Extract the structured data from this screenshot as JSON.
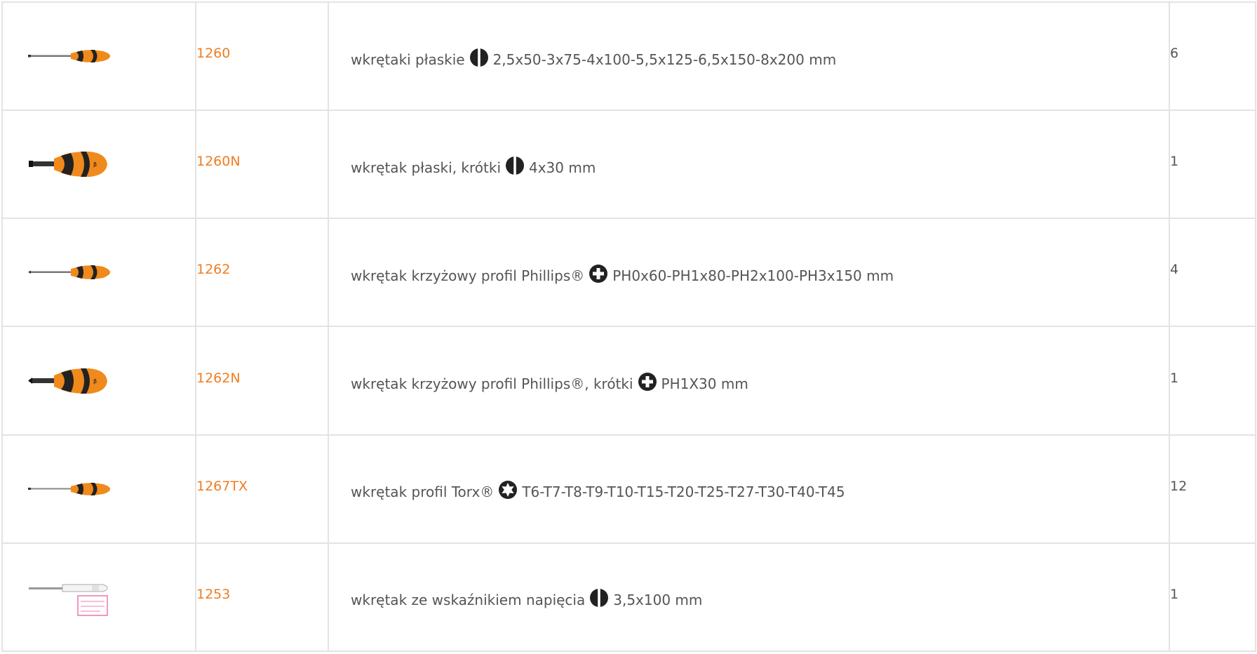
{
  "table": {
    "rows": [
      {
        "code": "1260",
        "text": "wkrętaki płaskie",
        "profile_icon": "slotted-profile-icon",
        "spec": "2,5x50-3x75-4x100-5,5x125-6,5x150-8x200 mm",
        "qty": "6",
        "tool": "long-slotted-screwdriver"
      },
      {
        "code": "1260N",
        "text": "wkrętak płaski, krótki",
        "profile_icon": "slotted-profile-icon",
        "spec": "4x30 mm",
        "qty": "1",
        "tool": "stubby-slotted-screwdriver"
      },
      {
        "code": "1262",
        "text": "wkrętak krzyżowy profil Phillips®",
        "profile_icon": "phillips-profile-icon",
        "spec": "PH0x60-PH1x80-PH2x100-PH3x150 mm",
        "qty": "4",
        "tool": "long-phillips-screwdriver"
      },
      {
        "code": "1262N",
        "text": "wkrętak krzyżowy profil Phillips®, krótki",
        "profile_icon": "phillips-profile-icon",
        "spec": "PH1X30 mm",
        "qty": "1",
        "tool": "stubby-phillips-screwdriver"
      },
      {
        "code": "1267TX",
        "text": "wkrętak profil Torx®",
        "profile_icon": "torx-profile-icon",
        "spec": "T6-T7-T8-T9-T10-T15-T20-T25-T27-T30-T40-T45",
        "qty": "12",
        "tool": "torx-screwdriver"
      },
      {
        "code": "1253",
        "text": "wkrętak ze wskaźnikiem napięcia",
        "profile_icon": "slotted-profile-icon",
        "spec": "3,5x100 mm",
        "qty": "1",
        "tool": "voltage-tester-screwdriver"
      }
    ]
  },
  "colors": {
    "code": "#ef7d22",
    "text": "#555555",
    "border": "#e3e3e3",
    "handle_orange": "#f08a1c",
    "handle_black": "#222222"
  }
}
